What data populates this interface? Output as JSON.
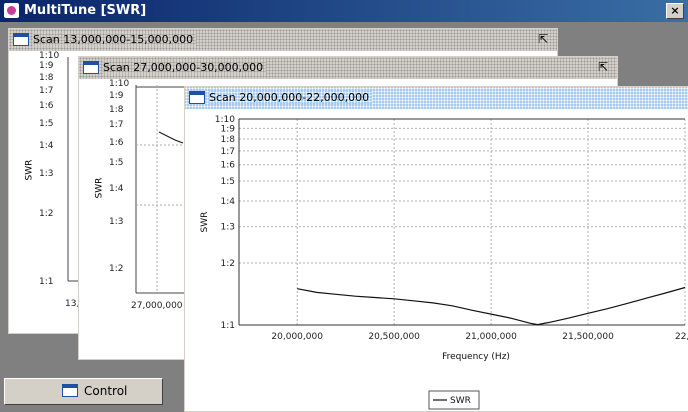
{
  "app": {
    "title": "MultiTune [SWR]",
    "close_glyph": "×"
  },
  "windows": [
    {
      "title": "Scan 13,000,000-15,000,000",
      "y_label": "SWR",
      "y_ticks": [
        "1:10",
        "1:9",
        "1:8",
        "1:7",
        "1:6",
        "1:5",
        "1:4",
        "1:3",
        "1:2",
        "1:1"
      ],
      "x_ticks_visible": [
        "13,"
      ]
    },
    {
      "title": "Scan 27,000,000-30,000,000",
      "y_label": "SWR",
      "y_ticks": [
        "1:10",
        "1:9",
        "1:8",
        "1:7",
        "1:6",
        "1:5",
        "1:4",
        "1:3",
        "1:2"
      ],
      "x_ticks_visible": [
        "27,000,000"
      ]
    },
    {
      "title": "Scan 20,000,000-22,000,000",
      "active": true
    }
  ],
  "chart_data": {
    "type": "line",
    "title": "",
    "xlabel": "Frequency (Hz)",
    "ylabel": "SWR",
    "y_scale": "log",
    "xlim": [
      19700000,
      22000000
    ],
    "ylim": [
      1.0,
      10.0
    ],
    "x_ticks": [
      {
        "v": 20000000,
        "label": "20,000,000"
      },
      {
        "v": 20500000,
        "label": "20,500,000"
      },
      {
        "v": 21000000,
        "label": "21,000,000"
      },
      {
        "v": 21500000,
        "label": "21,500,000"
      },
      {
        "v": 22000000,
        "label": "22,0"
      }
    ],
    "y_ticks": [
      {
        "v": 10,
        "label": "1:10"
      },
      {
        "v": 9,
        "label": "1:9"
      },
      {
        "v": 8,
        "label": "1:8"
      },
      {
        "v": 7,
        "label": "1:7"
      },
      {
        "v": 6,
        "label": "1:6"
      },
      {
        "v": 5,
        "label": "1:5"
      },
      {
        "v": 4,
        "label": "1:4"
      },
      {
        "v": 3,
        "label": "1:3"
      },
      {
        "v": 2,
        "label": "1:2"
      },
      {
        "v": 1,
        "label": "1:1"
      }
    ],
    "grid": true,
    "legend": "bottom-center",
    "series": [
      {
        "name": "SWR",
        "x": [
          20000000,
          20100000,
          20200000,
          20300000,
          20400000,
          20500000,
          20600000,
          20700000,
          20800000,
          20900000,
          21000000,
          21100000,
          21200000,
          21240000,
          21300000,
          21400000,
          21500000,
          21600000,
          21700000,
          21800000,
          21900000,
          22000000
        ],
        "y": [
          1.5,
          1.44,
          1.41,
          1.38,
          1.36,
          1.34,
          1.31,
          1.28,
          1.24,
          1.18,
          1.13,
          1.08,
          1.02,
          1.005,
          1.03,
          1.08,
          1.14,
          1.2,
          1.27,
          1.35,
          1.43,
          1.52
        ]
      }
    ]
  },
  "control": {
    "label": "Control"
  }
}
